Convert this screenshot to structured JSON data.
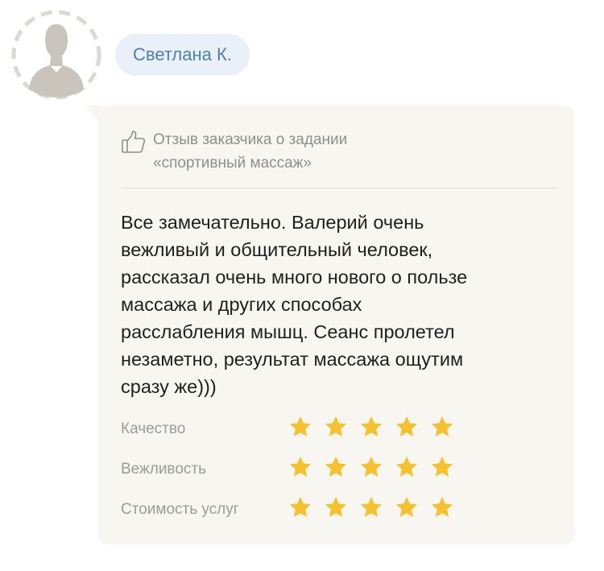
{
  "user": {
    "name": "Светлана К.",
    "avatar_icon": "user-silhouette-icon"
  },
  "review": {
    "header_icon": "thumbs-up-icon",
    "header_lines": [
      "Отзыв заказчика о задании",
      "«спортивный массаж»"
    ],
    "text_lines": [
      "Все замечательно. Валерий очень",
      "вежливый и общительный человек,",
      "рассказал очень много нового о пользе",
      "массажа и других способах",
      "расслабления мышц. Сеанс пролетел",
      "незаметно, результат массажа ощутим",
      "сразу же)))"
    ],
    "ratings": [
      {
        "label": "Качество",
        "stars": 5,
        "max": 5
      },
      {
        "label": "Вежливость",
        "stars": 5,
        "max": 5
      },
      {
        "label": "Стоимость услуг",
        "stars": 5,
        "max": 5
      }
    ]
  },
  "colors": {
    "accent": "#4e7fae",
    "pill_bg": "#eaf0f7",
    "card_bg": "#f8f6f0",
    "star": "#f5c12e"
  }
}
